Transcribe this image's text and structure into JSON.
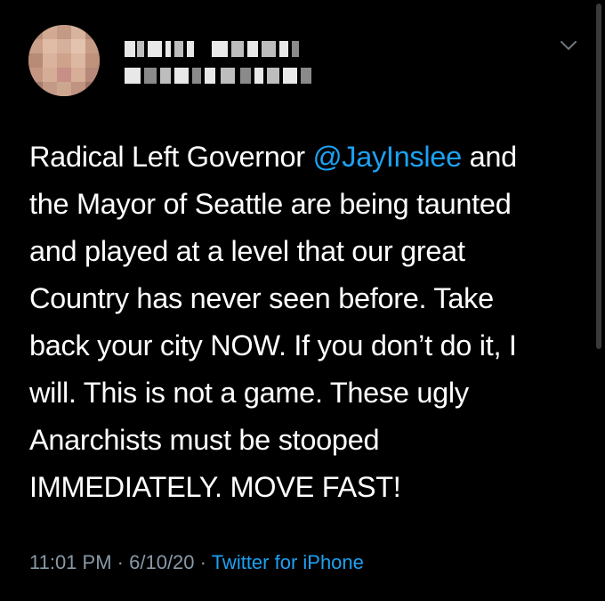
{
  "tweet": {
    "text_lines": [
      {
        "before": "Radical Left Governor ",
        "mention": "@JayInslee",
        "after": " and"
      },
      {
        "text": "the Mayor of Seattle are being taunted"
      },
      {
        "text": "and played at a level that our great"
      },
      {
        "text": "Country has never seen before. Take"
      },
      {
        "text": "back your city NOW. If you don’t do it, I"
      },
      {
        "text": "will. This is not a game. These ugly"
      },
      {
        "text": "Anarchists must be stooped"
      },
      {
        "text": "IMMEDIATELY. MOVE FAST!"
      }
    ],
    "time": "11:01 PM",
    "separator": "·",
    "date": "6/10/20",
    "source": "Twitter for iPhone"
  },
  "colors": {
    "background": "#000000",
    "text": "#ffffff",
    "link": "#1da1f2",
    "muted": "#8899a6"
  },
  "icons": {
    "menu": "chevron-down-icon"
  }
}
